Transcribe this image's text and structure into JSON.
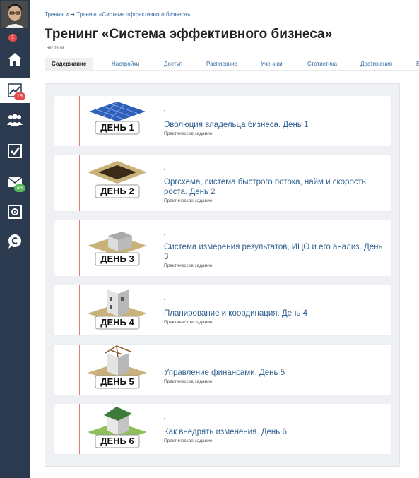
{
  "sidebar": {
    "avatar_badge": "1",
    "items": [
      {
        "name": "home",
        "icon": "home-icon"
      },
      {
        "name": "trainings",
        "icon": "chart-icon",
        "badge": "19",
        "active": true
      },
      {
        "name": "users",
        "icon": "users-icon"
      },
      {
        "name": "tasks",
        "icon": "checkbox-icon"
      },
      {
        "name": "messages",
        "icon": "mail-icon",
        "badge": "48"
      },
      {
        "name": "safe",
        "icon": "safe-icon"
      },
      {
        "name": "chat",
        "icon": "chat-icon"
      }
    ]
  },
  "breadcrumb": {
    "root": "Тренинги",
    "arrow": "➜",
    "current": "Тренинг «Система эффективного бизнеса»"
  },
  "page": {
    "title": "Тренинг «Система эффективного бизнеса»",
    "tags": "нет тегов"
  },
  "tabs": [
    {
      "label": "Содержание",
      "active": true
    },
    {
      "label": "Настройки"
    },
    {
      "label": "Доступ"
    },
    {
      "label": "Расписание"
    },
    {
      "label": "Ученики"
    },
    {
      "label": "Статистика"
    },
    {
      "label": "Достижения"
    },
    {
      "label": "Е"
    }
  ],
  "lessons": [
    {
      "day_label": "ДЕНЬ 1",
      "title": "Эволюция владельца бизнеса. День 1",
      "subtitle": "Практическое задание"
    },
    {
      "day_label": "ДЕНЬ 2",
      "title": "Оргсхема, система быстрого потока, найм и скорость роста. День 2",
      "subtitle": "Практическое задание"
    },
    {
      "day_label": "ДЕНЬ 3",
      "title": "Система измерения результатов, ИЦО и его анализ. День 3",
      "subtitle": "Практическое задание"
    },
    {
      "day_label": "ДЕНЬ 4",
      "title": "Планирование и координация. День 4",
      "subtitle": "Практическое задание"
    },
    {
      "day_label": "ДЕНЬ 5",
      "title": "Управление финансами. День 5",
      "subtitle": "Практическое задание"
    },
    {
      "day_label": "ДЕНЬ 6",
      "title": "Как внедрять изменения. День 6",
      "subtitle": "Практическое задание"
    }
  ],
  "colors": {
    "sidebar_bg": "#2b3a4f",
    "link": "#3a6ea5",
    "badge_red": "#e34a4a",
    "badge_green": "#5cb85c",
    "card_divider": "#e37b7b"
  }
}
